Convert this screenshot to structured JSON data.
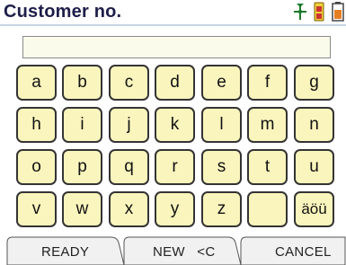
{
  "header": {
    "title": "Customer no.",
    "icons": [
      "fan-icon",
      "battery-plug-icon",
      "battery-icon"
    ]
  },
  "entry": {
    "value": ""
  },
  "keyboard": {
    "rows": [
      [
        "a",
        "b",
        "c",
        "d",
        "e",
        "f",
        "g"
      ],
      [
        "h",
        "i",
        "j",
        "k",
        "l",
        "m",
        "n"
      ],
      [
        "o",
        "p",
        "q",
        "r",
        "s",
        "t",
        "u"
      ],
      [
        "v",
        "w",
        "x",
        "y",
        "z",
        "",
        "äöü"
      ]
    ]
  },
  "softkeys": {
    "left": "READY",
    "middle": "NEW   <C",
    "right": "CANCEL"
  },
  "colors": {
    "key_fill": "#faf5bd",
    "title_text": "#1e1e4a",
    "field_fill": "#fbfbec"
  }
}
